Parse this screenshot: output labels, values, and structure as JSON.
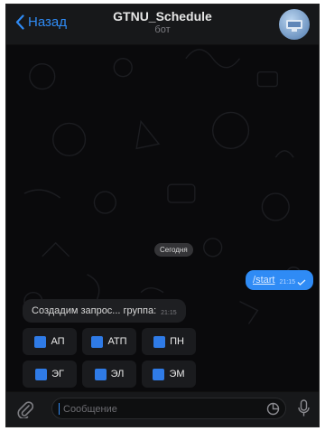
{
  "header": {
    "back_label": "Назад",
    "title": "GTNU_Schedule",
    "subtitle": "бот"
  },
  "chat": {
    "date_label": "Сегодня",
    "outgoing": {
      "text": "/start",
      "time": "21:15"
    },
    "incoming": {
      "text": "Создадим запрос... группа:",
      "time": "21:15"
    }
  },
  "keyboard": {
    "rows": [
      [
        "АП",
        "АТП",
        "ПН"
      ],
      [
        "ЭГ",
        "ЭЛ",
        "ЭМ"
      ]
    ]
  },
  "composer": {
    "placeholder": "Сообщение"
  },
  "colors": {
    "accent": "#2f8bf5",
    "background": "#0a0a0c",
    "bar": "#17181a"
  }
}
